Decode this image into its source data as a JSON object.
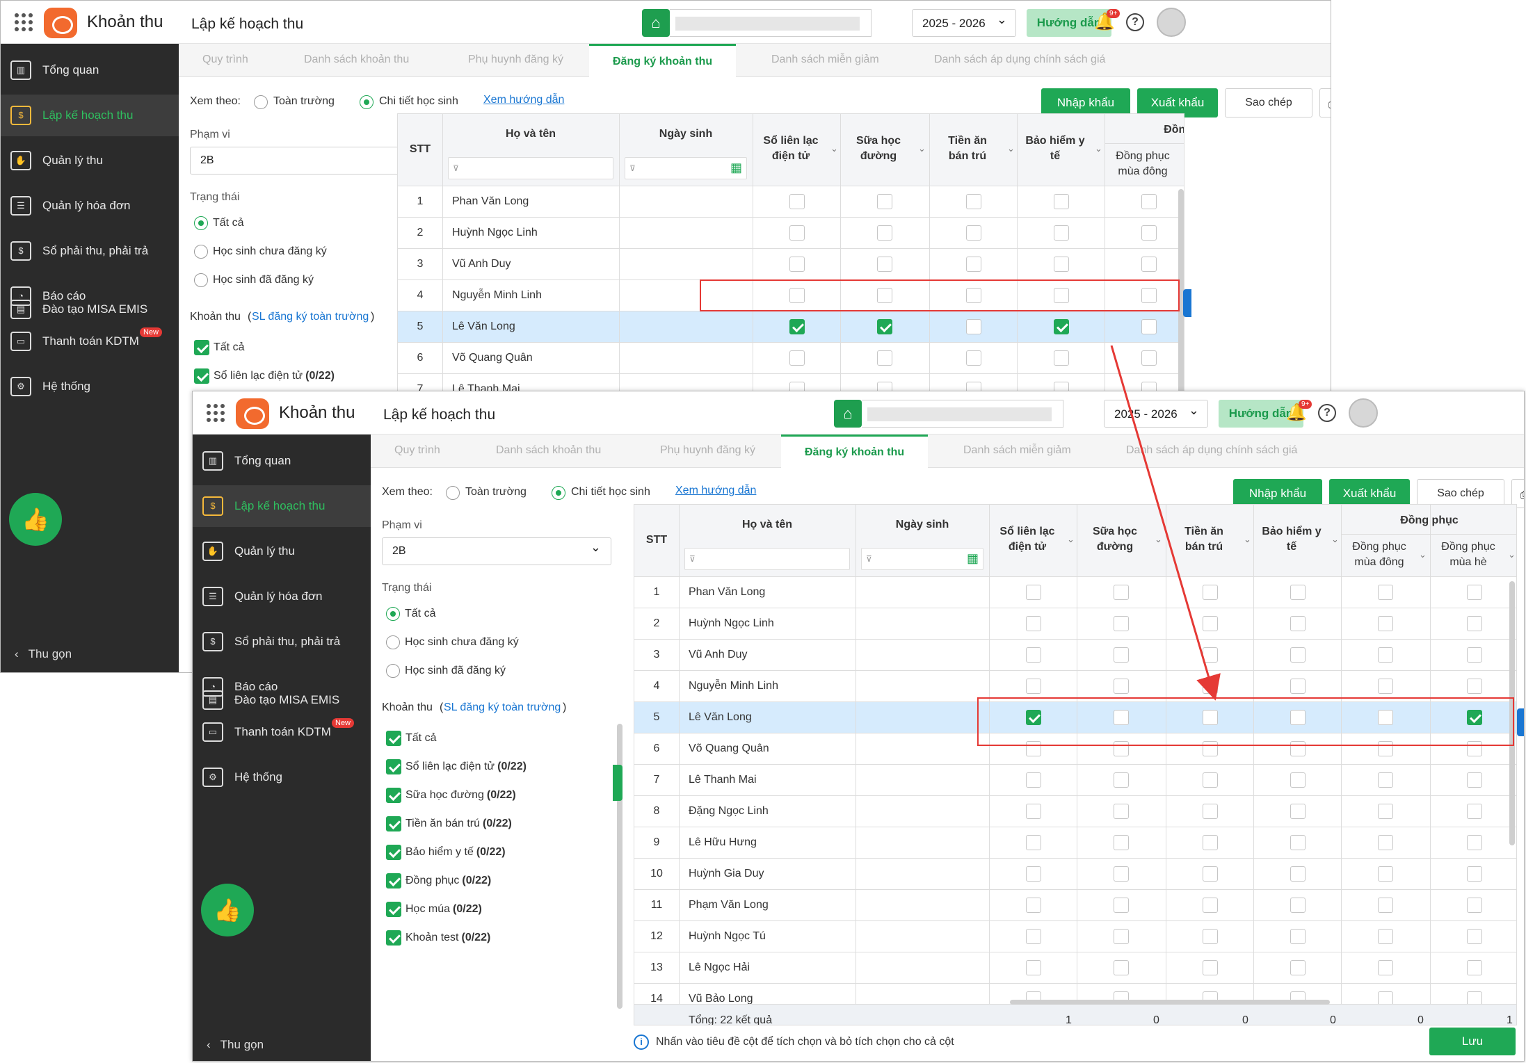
{
  "app": {
    "title": "Khoản thu",
    "page_title": "Lập kế hoạch thu",
    "year": "2025 - 2026",
    "guide": "Hướng dẫn",
    "notif_badge": "9+",
    "help": "?"
  },
  "sidebar": {
    "items": [
      {
        "label": "Tổng quan",
        "icon": "chart-icon"
      },
      {
        "label": "Lập kế hoạch thu",
        "icon": "calendar-money-icon",
        "active": true
      },
      {
        "label": "Quản lý thu",
        "icon": "hand-money-icon"
      },
      {
        "label": "Quản lý hóa đơn",
        "icon": "invoice-icon"
      },
      {
        "label": "Sổ phải thu, phải trả",
        "icon": "ledger-icon"
      },
      {
        "label": "Báo cáo",
        "icon": "pie-chart-icon"
      },
      {
        "label": "Thanh toán KDTM",
        "icon": "payment-icon",
        "badge": "New"
      },
      {
        "label": "Hệ thống",
        "icon": "gear-icon"
      },
      {
        "label": "Đào tạo MISA EMIS",
        "icon": "book-icon"
      }
    ],
    "collapse": "Thu gọn",
    "collapse_icon": "‹",
    "thumb_icon": "👍"
  },
  "tabs": [
    "Quy trình",
    "Danh sách khoản thu",
    "Phụ huynh đăng ký",
    "Đăng ký khoản thu",
    "Danh sách miễn giảm",
    "Danh sách áp dụng chính sách giá"
  ],
  "filters": {
    "view_by": "Xem theo:",
    "opt_all": "Toàn trường",
    "opt_detail": "Chi tiết học sinh",
    "guide_link": "Xem hướng dẫn",
    "scope_label": "Phạm vi",
    "scope_value": "2B",
    "status_label": "Trạng thái",
    "status_options": [
      "Tất cả",
      "Học sinh chưa đăng ký",
      "Học sinh đã đăng ký"
    ],
    "fees_label": "Khoản thu",
    "fees_link": "SL đăng ký toàn trường",
    "paren_open": "(",
    "paren_close": ")",
    "fees": [
      {
        "label": "Tất cả",
        "count": ""
      },
      {
        "label": "Sổ liên lạc điện tử",
        "count": "(0/22)"
      },
      {
        "label": "Sữa học đường",
        "count": "(0/22)"
      },
      {
        "label": "Tiền ăn bán trú",
        "count": "(0/22)"
      },
      {
        "label": "Bảo hiểm y tế",
        "count": "(0/22)"
      },
      {
        "label": "Đồng phục",
        "count": "(0/22)"
      },
      {
        "label": "Học múa",
        "count": "(0/22)"
      },
      {
        "label": "Khoản test",
        "count": "(0/22)"
      }
    ]
  },
  "actions": {
    "import": "Nhập khẩu",
    "export": "Xuất khẩu",
    "copy": "Sao chép",
    "print_icon": "⎙"
  },
  "table": {
    "headers": {
      "stt": "STT",
      "name": "Họ và tên",
      "dob": "Ngày sinh",
      "c1": [
        "Sổ liên lạc",
        "điện tử"
      ],
      "c2": [
        "Sữa học",
        "đường"
      ],
      "c3": [
        "Tiền ăn",
        "bán trú"
      ],
      "c4": [
        "Bảo hiểm y",
        "tế"
      ],
      "group": "Đồng phục",
      "c5": [
        "Đồng phục",
        "mùa đông"
      ],
      "c6": [
        "Đồng phục",
        "mùa hè"
      ]
    },
    "filter_icon": "⊽",
    "calendar_icon": "▦",
    "chevron": "⌄",
    "rows": [
      {
        "stt": "1",
        "name": "Phan Văn Long"
      },
      {
        "stt": "2",
        "name": "Huỳnh Ngọc Linh"
      },
      {
        "stt": "3",
        "name": "Vũ Anh Duy"
      },
      {
        "stt": "4",
        "name": "Nguyễn Minh Linh"
      },
      {
        "stt": "5",
        "name": "Lê Văn Long"
      },
      {
        "stt": "6",
        "name": "Võ Quang Quân"
      },
      {
        "stt": "7",
        "name": "Lê Thanh Mai"
      },
      {
        "stt": "8",
        "name": "Đặng Ngọc Linh"
      },
      {
        "stt": "9",
        "name": "Lê Hữu Hưng"
      },
      {
        "stt": "10",
        "name": "Huỳnh Gia Duy"
      },
      {
        "stt": "11",
        "name": "Phạm Văn Long"
      },
      {
        "stt": "12",
        "name": "Huỳnh Ngọc Tú"
      },
      {
        "stt": "13",
        "name": "Lê Ngọc Hải"
      },
      {
        "stt": "14",
        "name": "Vũ Bảo Long"
      }
    ],
    "before_checked": [
      true,
      true,
      false,
      true,
      false,
      true
    ],
    "after_checked": [
      true,
      false,
      false,
      false,
      false,
      true
    ],
    "footer": {
      "total": "Tổng: 22 kết quả",
      "sums": [
        "1",
        "0",
        "0",
        "0",
        "0",
        "1"
      ]
    }
  },
  "hint": "Nhấn vào tiêu đề cột để tích chọn và bỏ tích chọn cho cả cột",
  "hint_icon": "i",
  "save": "Lưu",
  "colors": {
    "green": "#1fa855",
    "red": "#e53935",
    "sidebar": "#2b2b2b",
    "selected_row": "#d6ebfd"
  }
}
